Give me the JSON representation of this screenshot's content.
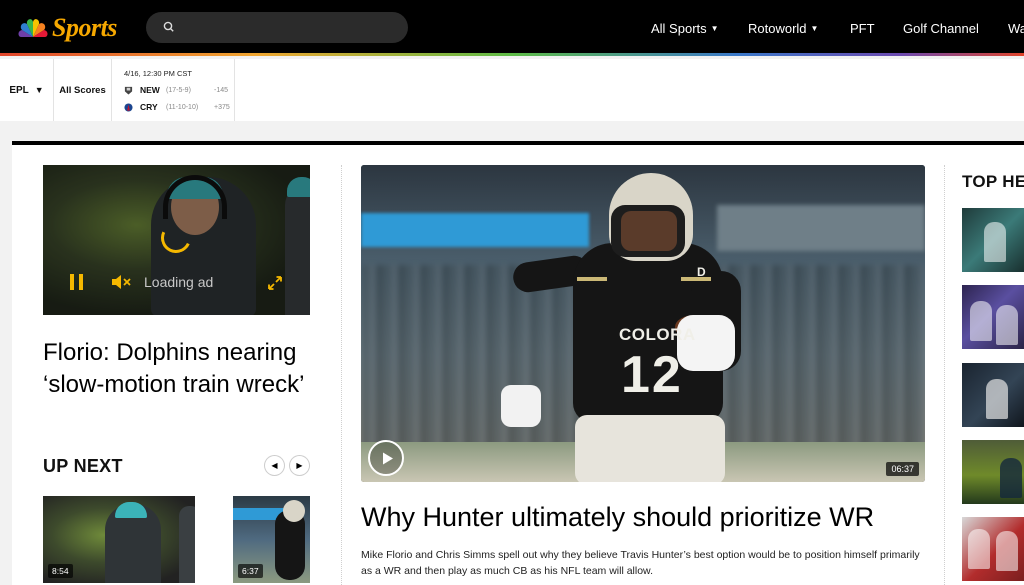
{
  "nav": {
    "brand": "Sports",
    "links": [
      {
        "label": "All Sports",
        "has_caret": true
      },
      {
        "label": "Rotoworld",
        "has_caret": true
      },
      {
        "label": "PFT",
        "has_caret": false
      },
      {
        "label": "Golf Channel",
        "has_caret": false
      },
      {
        "label": "Wa",
        "has_caret": false
      }
    ]
  },
  "scores": {
    "league": "EPL",
    "all_scores": "All Scores",
    "game": {
      "time": "4/16, 12:30 PM CST",
      "teams": [
        {
          "abbr": "NEW",
          "record": "(17-5-9)",
          "odds": "-145"
        },
        {
          "abbr": "CRY",
          "record": "(11-10-10)",
          "odds": "+375"
        }
      ]
    }
  },
  "left": {
    "player_loading": "Loading ad",
    "headline": "Florio: Dolphins nearing ‘slow-motion train wreck’",
    "upnext_title": "UP NEXT",
    "thumbs": [
      {
        "duration": "8:54"
      },
      {
        "duration": "6:37"
      }
    ]
  },
  "hero": {
    "duration": "06:37",
    "jersey_word": "COLORA",
    "jersey_number": "12",
    "jersey_letter": "D",
    "headline": "Why Hunter ultimately should prioritize WR",
    "summary": "Mike Florio and Chris Simms spell out why they believe Travis Hunter’s best option would be to position himself primarily as a WR and then play as much CB as his NFL team will allow."
  },
  "right": {
    "heading": "TOP HE"
  },
  "colors": {
    "accent": "#f6a800",
    "nav_bg": "#000000"
  }
}
